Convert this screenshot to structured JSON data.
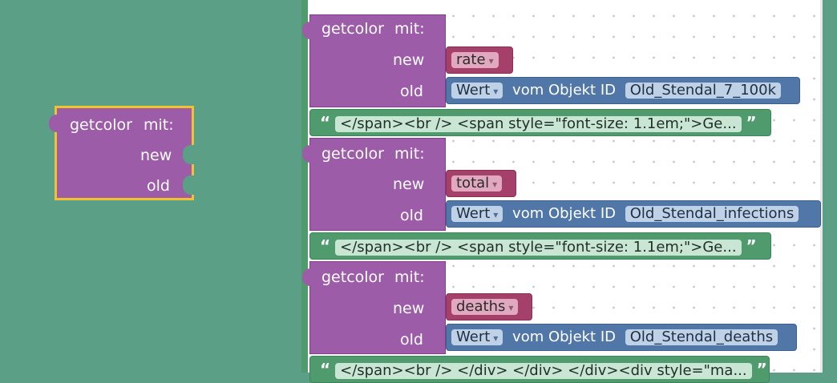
{
  "flyout_block": {
    "title": "getcolor",
    "mit": "mit:",
    "new": "new",
    "old": "old"
  },
  "blocks": [
    {
      "title": "getcolor",
      "mit": "mit:",
      "new_label": "new",
      "old_label": "old",
      "new_var": "rate",
      "wert": "Wert",
      "vom": "vom Objekt ID",
      "obj_id": "Old_Stendal_7_100k",
      "string": "</span><br /> <span style=\"font-size: 1.1em;\">Ge..."
    },
    {
      "title": "getcolor",
      "mit": "mit:",
      "new_label": "new",
      "old_label": "old",
      "new_var": "total",
      "wert": "Wert",
      "vom": "vom Objekt ID",
      "obj_id": "Old_Stendal_infections",
      "string": "</span><br /> <span style=\"font-size: 1.1em;\">Ge..."
    },
    {
      "title": "getcolor",
      "mit": "mit:",
      "new_label": "new",
      "old_label": "old",
      "new_var": "deaths",
      "wert": "Wert",
      "vom": "vom Objekt ID",
      "obj_id": "Old_Stendal_deaths",
      "string": "</span><br /> </div> </div> </div><div style=\"ma..."
    }
  ],
  "glyphs": {
    "open_quote": "“",
    "close_quote": "”",
    "dropdown": "▾"
  },
  "colors": {
    "procedure": "#9c5ca8",
    "variable": "#a5406a",
    "value": "#5177a8",
    "text": "#4f9b6e",
    "selected_outline": "#f2c12e",
    "toolbox_bg": "#5b9f86"
  }
}
